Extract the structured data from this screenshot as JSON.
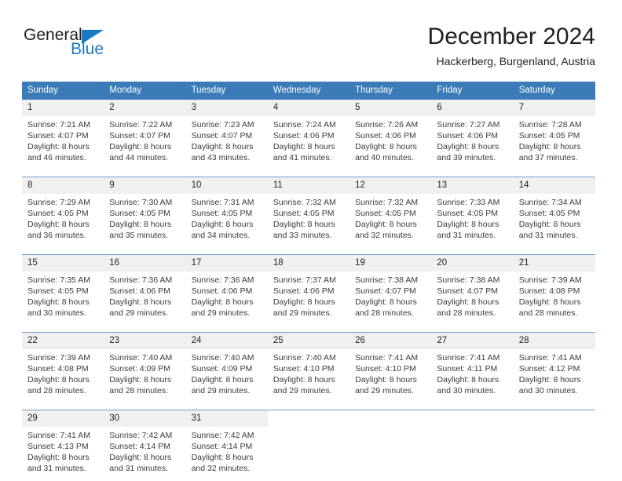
{
  "logo": {
    "word_top": "General",
    "word_bottom": "Blue",
    "triangle_icon": "blue-triangle-icon",
    "brand_color": "#1b79c3",
    "text_color": "#231f20"
  },
  "header": {
    "title": "December 2024",
    "subtitle": "Hackerberg, Burgenland, Austria"
  },
  "calendar": {
    "header_bg": "#3b7cb8",
    "daynum_bg": "#f0f0f0",
    "weekdays": [
      "Sunday",
      "Monday",
      "Tuesday",
      "Wednesday",
      "Thursday",
      "Friday",
      "Saturday"
    ],
    "weeks": [
      [
        {
          "day": "1",
          "sunrise": "Sunrise: 7:21 AM",
          "sunset": "Sunset: 4:07 PM",
          "daylight_line1": "Daylight: 8 hours",
          "daylight_line2": "and 46 minutes."
        },
        {
          "day": "2",
          "sunrise": "Sunrise: 7:22 AM",
          "sunset": "Sunset: 4:07 PM",
          "daylight_line1": "Daylight: 8 hours",
          "daylight_line2": "and 44 minutes."
        },
        {
          "day": "3",
          "sunrise": "Sunrise: 7:23 AM",
          "sunset": "Sunset: 4:07 PM",
          "daylight_line1": "Daylight: 8 hours",
          "daylight_line2": "and 43 minutes."
        },
        {
          "day": "4",
          "sunrise": "Sunrise: 7:24 AM",
          "sunset": "Sunset: 4:06 PM",
          "daylight_line1": "Daylight: 8 hours",
          "daylight_line2": "and 41 minutes."
        },
        {
          "day": "5",
          "sunrise": "Sunrise: 7:26 AM",
          "sunset": "Sunset: 4:06 PM",
          "daylight_line1": "Daylight: 8 hours",
          "daylight_line2": "and 40 minutes."
        },
        {
          "day": "6",
          "sunrise": "Sunrise: 7:27 AM",
          "sunset": "Sunset: 4:06 PM",
          "daylight_line1": "Daylight: 8 hours",
          "daylight_line2": "and 39 minutes."
        },
        {
          "day": "7",
          "sunrise": "Sunrise: 7:28 AM",
          "sunset": "Sunset: 4:05 PM",
          "daylight_line1": "Daylight: 8 hours",
          "daylight_line2": "and 37 minutes."
        }
      ],
      [
        {
          "day": "8",
          "sunrise": "Sunrise: 7:29 AM",
          "sunset": "Sunset: 4:05 PM",
          "daylight_line1": "Daylight: 8 hours",
          "daylight_line2": "and 36 minutes."
        },
        {
          "day": "9",
          "sunrise": "Sunrise: 7:30 AM",
          "sunset": "Sunset: 4:05 PM",
          "daylight_line1": "Daylight: 8 hours",
          "daylight_line2": "and 35 minutes."
        },
        {
          "day": "10",
          "sunrise": "Sunrise: 7:31 AM",
          "sunset": "Sunset: 4:05 PM",
          "daylight_line1": "Daylight: 8 hours",
          "daylight_line2": "and 34 minutes."
        },
        {
          "day": "11",
          "sunrise": "Sunrise: 7:32 AM",
          "sunset": "Sunset: 4:05 PM",
          "daylight_line1": "Daylight: 8 hours",
          "daylight_line2": "and 33 minutes."
        },
        {
          "day": "12",
          "sunrise": "Sunrise: 7:32 AM",
          "sunset": "Sunset: 4:05 PM",
          "daylight_line1": "Daylight: 8 hours",
          "daylight_line2": "and 32 minutes."
        },
        {
          "day": "13",
          "sunrise": "Sunrise: 7:33 AM",
          "sunset": "Sunset: 4:05 PM",
          "daylight_line1": "Daylight: 8 hours",
          "daylight_line2": "and 31 minutes."
        },
        {
          "day": "14",
          "sunrise": "Sunrise: 7:34 AM",
          "sunset": "Sunset: 4:05 PM",
          "daylight_line1": "Daylight: 8 hours",
          "daylight_line2": "and 31 minutes."
        }
      ],
      [
        {
          "day": "15",
          "sunrise": "Sunrise: 7:35 AM",
          "sunset": "Sunset: 4:05 PM",
          "daylight_line1": "Daylight: 8 hours",
          "daylight_line2": "and 30 minutes."
        },
        {
          "day": "16",
          "sunrise": "Sunrise: 7:36 AM",
          "sunset": "Sunset: 4:06 PM",
          "daylight_line1": "Daylight: 8 hours",
          "daylight_line2": "and 29 minutes."
        },
        {
          "day": "17",
          "sunrise": "Sunrise: 7:36 AM",
          "sunset": "Sunset: 4:06 PM",
          "daylight_line1": "Daylight: 8 hours",
          "daylight_line2": "and 29 minutes."
        },
        {
          "day": "18",
          "sunrise": "Sunrise: 7:37 AM",
          "sunset": "Sunset: 4:06 PM",
          "daylight_line1": "Daylight: 8 hours",
          "daylight_line2": "and 29 minutes."
        },
        {
          "day": "19",
          "sunrise": "Sunrise: 7:38 AM",
          "sunset": "Sunset: 4:07 PM",
          "daylight_line1": "Daylight: 8 hours",
          "daylight_line2": "and 28 minutes."
        },
        {
          "day": "20",
          "sunrise": "Sunrise: 7:38 AM",
          "sunset": "Sunset: 4:07 PM",
          "daylight_line1": "Daylight: 8 hours",
          "daylight_line2": "and 28 minutes."
        },
        {
          "day": "21",
          "sunrise": "Sunrise: 7:39 AM",
          "sunset": "Sunset: 4:08 PM",
          "daylight_line1": "Daylight: 8 hours",
          "daylight_line2": "and 28 minutes."
        }
      ],
      [
        {
          "day": "22",
          "sunrise": "Sunrise: 7:39 AM",
          "sunset": "Sunset: 4:08 PM",
          "daylight_line1": "Daylight: 8 hours",
          "daylight_line2": "and 28 minutes."
        },
        {
          "day": "23",
          "sunrise": "Sunrise: 7:40 AM",
          "sunset": "Sunset: 4:09 PM",
          "daylight_line1": "Daylight: 8 hours",
          "daylight_line2": "and 28 minutes."
        },
        {
          "day": "24",
          "sunrise": "Sunrise: 7:40 AM",
          "sunset": "Sunset: 4:09 PM",
          "daylight_line1": "Daylight: 8 hours",
          "daylight_line2": "and 29 minutes."
        },
        {
          "day": "25",
          "sunrise": "Sunrise: 7:40 AM",
          "sunset": "Sunset: 4:10 PM",
          "daylight_line1": "Daylight: 8 hours",
          "daylight_line2": "and 29 minutes."
        },
        {
          "day": "26",
          "sunrise": "Sunrise: 7:41 AM",
          "sunset": "Sunset: 4:10 PM",
          "daylight_line1": "Daylight: 8 hours",
          "daylight_line2": "and 29 minutes."
        },
        {
          "day": "27",
          "sunrise": "Sunrise: 7:41 AM",
          "sunset": "Sunset: 4:11 PM",
          "daylight_line1": "Daylight: 8 hours",
          "daylight_line2": "and 30 minutes."
        },
        {
          "day": "28",
          "sunrise": "Sunrise: 7:41 AM",
          "sunset": "Sunset: 4:12 PM",
          "daylight_line1": "Daylight: 8 hours",
          "daylight_line2": "and 30 minutes."
        }
      ],
      [
        {
          "day": "29",
          "sunrise": "Sunrise: 7:41 AM",
          "sunset": "Sunset: 4:13 PM",
          "daylight_line1": "Daylight: 8 hours",
          "daylight_line2": "and 31 minutes."
        },
        {
          "day": "30",
          "sunrise": "Sunrise: 7:42 AM",
          "sunset": "Sunset: 4:14 PM",
          "daylight_line1": "Daylight: 8 hours",
          "daylight_line2": "and 31 minutes."
        },
        {
          "day": "31",
          "sunrise": "Sunrise: 7:42 AM",
          "sunset": "Sunset: 4:14 PM",
          "daylight_line1": "Daylight: 8 hours",
          "daylight_line2": "and 32 minutes."
        },
        {
          "day": "",
          "sunrise": "",
          "sunset": "",
          "daylight_line1": "",
          "daylight_line2": ""
        },
        {
          "day": "",
          "sunrise": "",
          "sunset": "",
          "daylight_line1": "",
          "daylight_line2": ""
        },
        {
          "day": "",
          "sunrise": "",
          "sunset": "",
          "daylight_line1": "",
          "daylight_line2": ""
        },
        {
          "day": "",
          "sunrise": "",
          "sunset": "",
          "daylight_line1": "",
          "daylight_line2": ""
        }
      ]
    ]
  }
}
